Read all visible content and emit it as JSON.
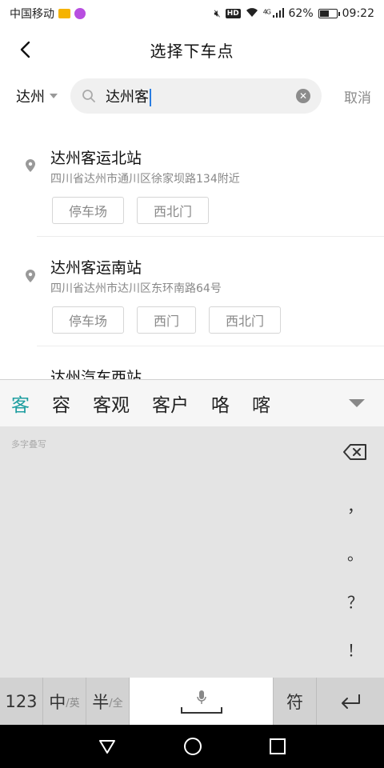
{
  "status_bar": {
    "carrier": "中国移动",
    "network": "4G",
    "hd": "HD",
    "battery": "62%",
    "battery_level": 0.62,
    "time": "09:22"
  },
  "header": {
    "title": "选择下车点"
  },
  "search": {
    "city": "达州",
    "query": "达州客",
    "cancel_label": "取消"
  },
  "results": [
    {
      "name": "达州客运北站",
      "address": "四川省达州市通川区徐家坝路134附近",
      "tags": [
        "停车场",
        "西北门"
      ]
    },
    {
      "name": "达州客运南站",
      "address": "四川省达州市达川区东环南路64号",
      "tags": [
        "停车场",
        "西门",
        "西北门"
      ]
    },
    {
      "name": "达州汽车西站",
      "address": "",
      "tags": []
    }
  ],
  "keyboard": {
    "candidates": [
      "客",
      "容",
      "客观",
      "客户",
      "咯",
      "喀"
    ],
    "handwrite_label": "多字叠写",
    "punctuation": [
      "，",
      "。",
      "？",
      "！"
    ],
    "keys": {
      "num": "123",
      "zh": "中",
      "zh_sub": "/英",
      "half": "半",
      "half_sub": "/全",
      "symbol": "符"
    }
  },
  "colors": {
    "accent": "#1e9ea0",
    "cursor": "#2a7de1"
  }
}
